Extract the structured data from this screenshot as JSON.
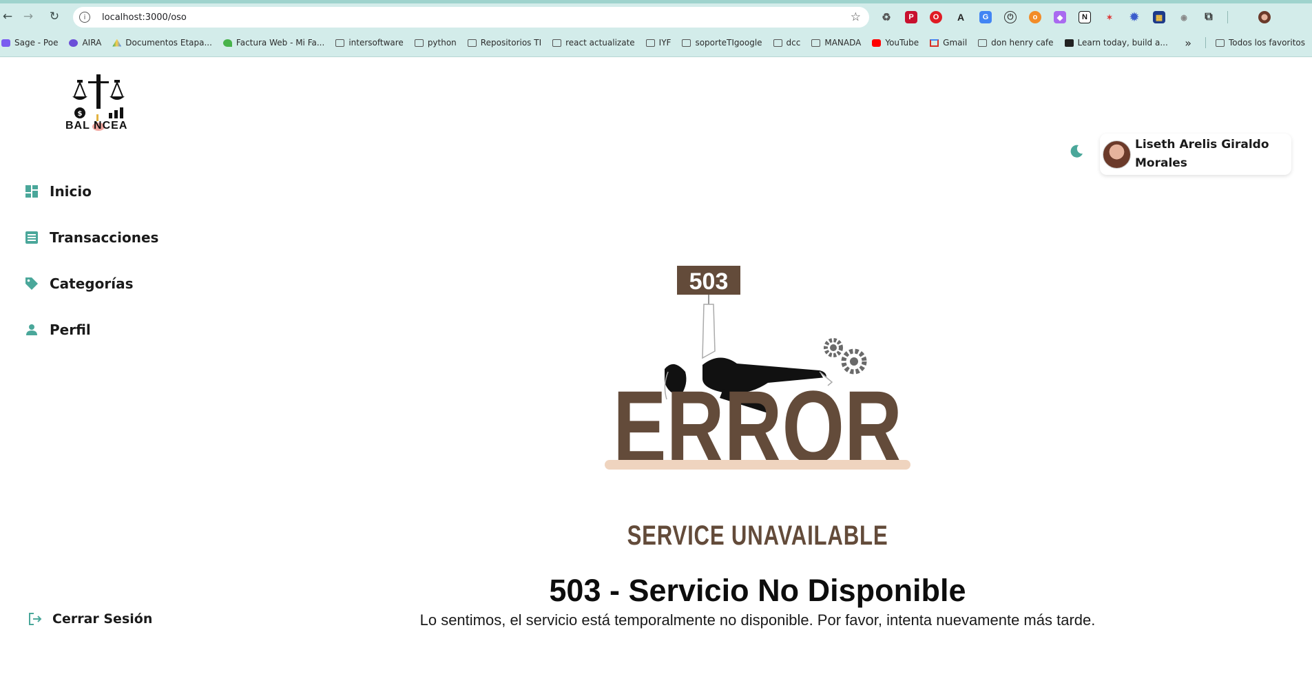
{
  "browser": {
    "url": "localhost:3000/oso",
    "bookmarks": [
      {
        "label": "Sage - Poe",
        "icon": "poe-icon",
        "color": "#7a5cf0"
      },
      {
        "label": "AIRA",
        "icon": "aira-icon",
        "color": "#6b4fd8"
      },
      {
        "label": "Documentos Etapa...",
        "icon": "drive-icon",
        "color": "#1fa463"
      },
      {
        "label": "Factura Web - Mi Fa...",
        "icon": "factura-icon",
        "color": "#48b34b"
      },
      {
        "label": "intersoftware",
        "icon": "folder-icon",
        "color": ""
      },
      {
        "label": "python",
        "icon": "folder-icon",
        "color": ""
      },
      {
        "label": "Repositorios TI",
        "icon": "folder-icon",
        "color": ""
      },
      {
        "label": "react actualizate",
        "icon": "folder-icon",
        "color": ""
      },
      {
        "label": "IYF",
        "icon": "folder-icon",
        "color": ""
      },
      {
        "label": "soporteTIgoogle",
        "icon": "folder-icon",
        "color": ""
      },
      {
        "label": "dcc",
        "icon": "folder-icon",
        "color": ""
      },
      {
        "label": "MANADA",
        "icon": "folder-icon",
        "color": ""
      },
      {
        "label": "YouTube",
        "icon": "youtube-icon",
        "color": "#ff0000"
      },
      {
        "label": "Gmail",
        "icon": "gmail-icon",
        "color": "#d93025"
      },
      {
        "label": "don henry cafe",
        "icon": "folder-icon",
        "color": ""
      },
      {
        "label": "Learn today, build a...",
        "icon": "learn-icon",
        "color": "#222222"
      }
    ],
    "more_bookmarks": "»",
    "all_bookmarks": "Todos los favoritos"
  },
  "app": {
    "logo_text": "BAL NCEA",
    "nav": [
      {
        "label": "Inicio",
        "icon": "dashboard-icon"
      },
      {
        "label": "Transacciones",
        "icon": "list-icon"
      },
      {
        "label": "Categorías",
        "icon": "tag-icon"
      },
      {
        "label": "Perfil",
        "icon": "person-icon"
      }
    ],
    "logout_label": "Cerrar Sesión",
    "user_name": "Liseth Arelis Giraldo Morales",
    "accent_color": "#4aa79a"
  },
  "error": {
    "sign_code": "503",
    "big_word": "ERROR",
    "subtitle_image": "SERVICE UNAVAILABLE",
    "title": "503 - Servicio No Disponible",
    "message": "Lo sentimos, el servicio está temporalmente no disponible. Por favor, intenta nuevamente más tarde.",
    "brown_color": "#634b3a"
  }
}
